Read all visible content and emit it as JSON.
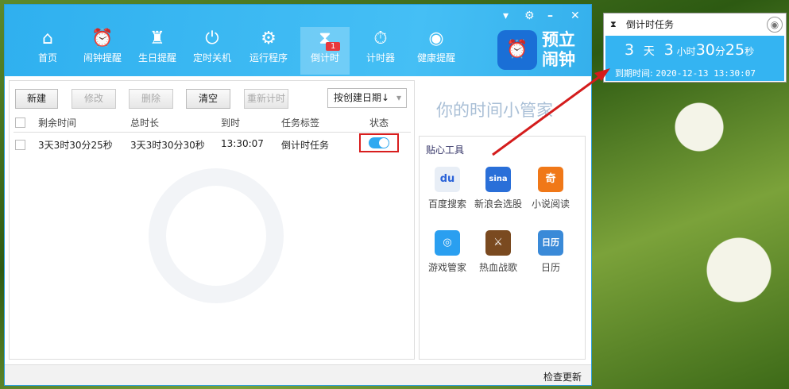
{
  "nav": [
    {
      "label": "首页",
      "icon": "home-icon"
    },
    {
      "label": "闹钟提醒",
      "icon": "alarm-icon"
    },
    {
      "label": "生日提醒",
      "icon": "cake-icon"
    },
    {
      "label": "定时关机",
      "icon": "power-icon"
    },
    {
      "label": "运行程序",
      "icon": "gear-icon"
    },
    {
      "label": "倒计时",
      "icon": "hourglass-icon",
      "badge": "1"
    },
    {
      "label": "计时器",
      "icon": "stopwatch-icon"
    },
    {
      "label": "健康提醒",
      "icon": "eye-icon"
    }
  ],
  "logo": {
    "text": "预立闹钟"
  },
  "toolbar": {
    "new": "新建",
    "edit": "修改",
    "delete": "删除",
    "clear": "清空",
    "restart": "重新计时",
    "sort": "按创建日期↓"
  },
  "table": {
    "headers": [
      "剩余时间",
      "总时长",
      "到时",
      "任务标签",
      "状态"
    ],
    "rows": [
      {
        "remaining": "3天3时30分25秒",
        "total": "3天3时30分30秒",
        "due": "13:30:07",
        "tag": "倒计时任务",
        "enabled": true
      }
    ]
  },
  "right": {
    "slogan": "你的时间小管家",
    "tools_title": "贴心工具",
    "tools": [
      {
        "label": "百度搜索",
        "icon": "du"
      },
      {
        "label": "新浪会选股",
        "icon": "sina"
      },
      {
        "label": "小说阅读",
        "icon": "奇"
      },
      {
        "label": "游戏管家",
        "icon": "◎"
      },
      {
        "label": "热血战歌",
        "icon": "⚔"
      },
      {
        "label": "日历",
        "icon": "日历"
      }
    ]
  },
  "footer": {
    "update": "检查更新"
  },
  "popup": {
    "title": "倒计时任务",
    "days": "3",
    "day_unit": "天",
    "hours": "3",
    "hour_unit": "小时",
    "minutes": "30",
    "minute_unit": "分",
    "seconds": "25",
    "second_unit": "秒",
    "expire_label": "到期时间:",
    "expire_value": "2020-12-13 13:30:07"
  },
  "colors": {
    "header": "#38b6f0",
    "highlight": "#d81e1e"
  }
}
